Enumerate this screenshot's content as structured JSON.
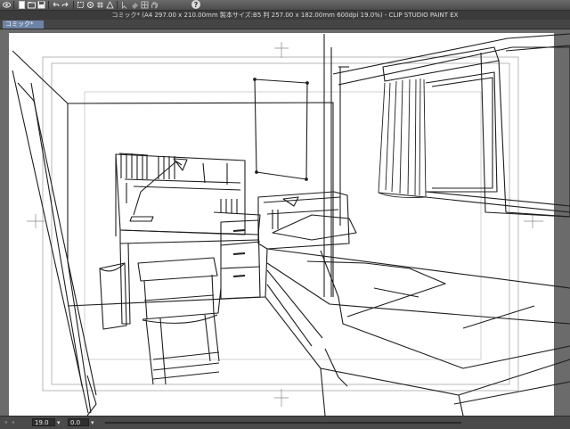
{
  "toolbar": {
    "icons": [
      "app-menu-icon",
      "new-icon",
      "open-icon",
      "save-icon",
      "undo-icon",
      "redo-icon",
      "transform-icon",
      "snap-ruler-icon",
      "snap-grid-icon",
      "snap-perspective-icon",
      "select-icon",
      "eraser-icon",
      "grid-icon",
      "hand-icon",
      "help-icon"
    ],
    "help_glyph": "?"
  },
  "window": {
    "title": "コミック* (A4 297.00 x 210.00mm 製本サイズ:B5 判 257.00 x 182.00mm 600dpi 19.0%)  - CLIP STUDIO PAINT EX"
  },
  "tab": {
    "label": "コミック*"
  },
  "status": {
    "zoom": "19.0",
    "angle": "0.0"
  },
  "colors": {
    "accent": "#6d84a6",
    "canvas_bg": "#6b6b6b",
    "paper": "#ffffff",
    "line": "#222222"
  }
}
